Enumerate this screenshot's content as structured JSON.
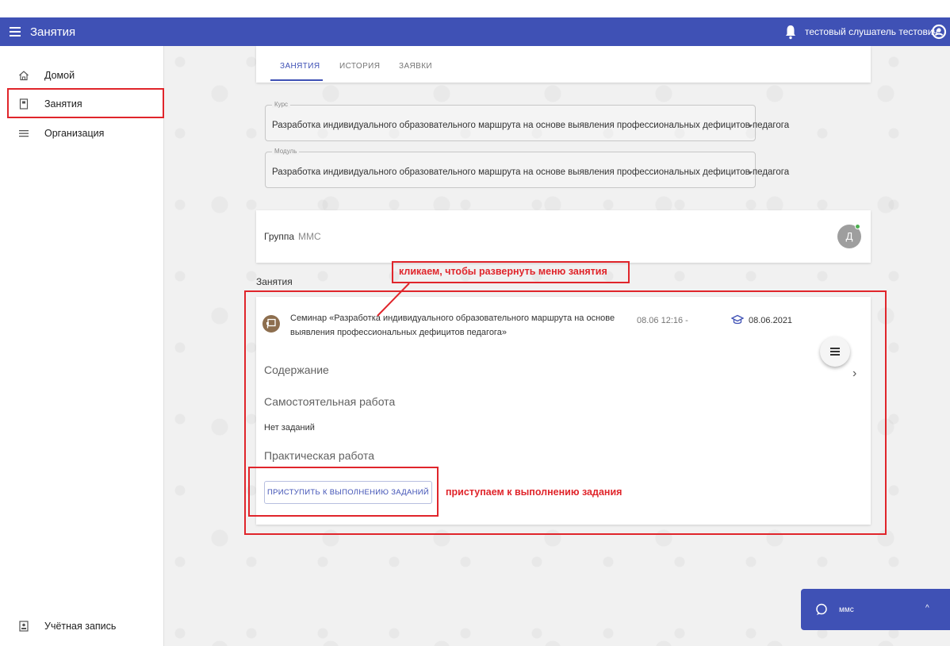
{
  "appbar": {
    "title": "Занятия",
    "user_name": "тестовый слушатель тестович"
  },
  "sidebar": {
    "items": [
      {
        "label": "Домой",
        "icon": "home-icon"
      },
      {
        "label": "Занятия",
        "icon": "book-icon"
      },
      {
        "label": "Организация",
        "icon": "list-icon"
      }
    ],
    "account_label": "Учётная запись"
  },
  "tabs": [
    "ЗАНЯТИЯ",
    "ИСТОРИЯ",
    "ЗАЯВКИ"
  ],
  "course": {
    "label": "Курс",
    "value": "Разработка индивидуального образовательного маршрута на основе выявления профессиональных дефицитов педагога"
  },
  "module": {
    "label": "Модуль",
    "value": "Разработка индивидуального образовательного маршрута на основе выявления профессиональных дефицитов педагога"
  },
  "group": {
    "label": "Группа",
    "value": "ММС",
    "avatar_letter": "Д"
  },
  "sessions_title": "Занятия",
  "lesson": {
    "title": "Семинар «Разработка индивидуального образовательного маршрута на основе выявления профессиональных дефицитов педагога»",
    "time": "08.06 12:16 -",
    "date": "08.06.2021",
    "content_heading": "Содержание",
    "self_work_heading": "Самостоятельная работа",
    "no_tasks": "Нет заданий",
    "practical_heading": "Практическая работа",
    "start_button": "ПРИСТУПИТЬ К ВЫПОЛНЕНИЮ ЗАДАНИЙ"
  },
  "annotations": {
    "expand_hint": "кликаем, чтобы развернуть меню занятия",
    "start_hint": "приступаем к выполнению задания"
  },
  "chat": {
    "label": "ммс"
  },
  "colors": {
    "primary": "#3f51b5",
    "annotation": "#e0252b",
    "background": "#f1f1f1"
  }
}
